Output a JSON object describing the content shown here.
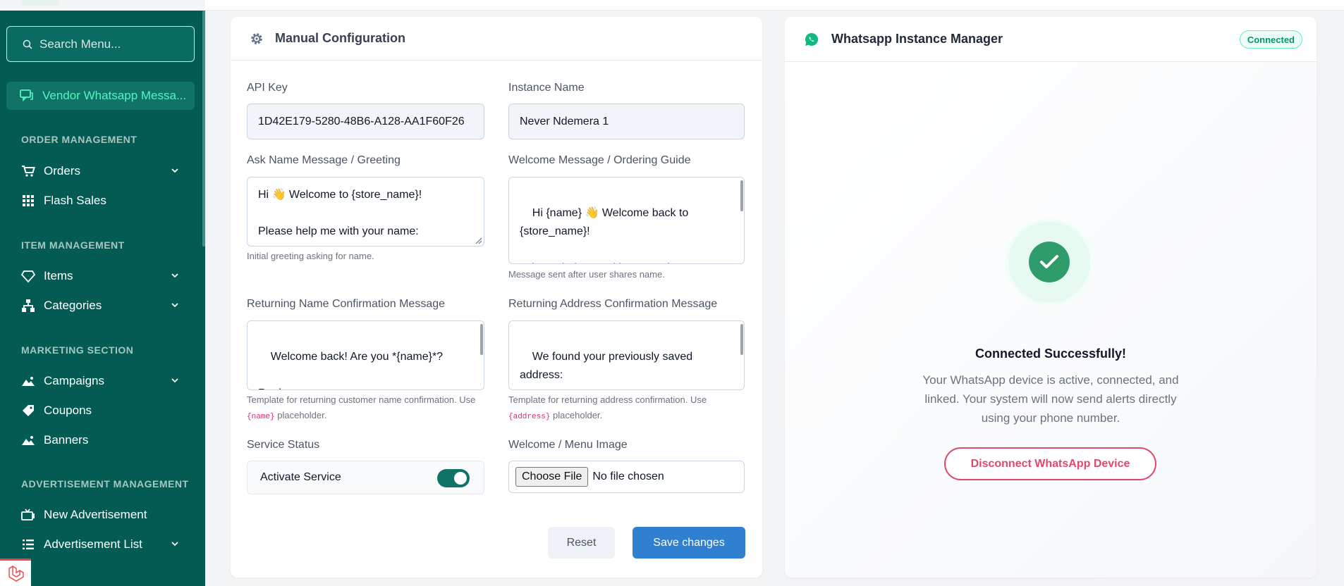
{
  "sidebar": {
    "search_placeholder": "Search Menu...",
    "active_item": "Vendor Whatsapp Messa...",
    "sections": {
      "order": "ORDER MANAGEMENT",
      "item": "ITEM MANAGEMENT",
      "marketing": "MARKETING SECTION",
      "ads": "ADVERTISEMENT MANAGEMENT"
    },
    "items": {
      "orders": "Orders",
      "flash_sales": "Flash Sales",
      "items": "Items",
      "categories": "Categories",
      "campaigns": "Campaigns",
      "coupons": "Coupons",
      "banners": "Banners",
      "new_ad": "New Advertisement",
      "ad_list": "Advertisement List"
    }
  },
  "config": {
    "title": "Manual Configuration",
    "api_key_label": "API Key",
    "api_key_value": "1D42E179-5280-48B6-A128-AA1F60F26",
    "instance_label": "Instance Name",
    "instance_value": "Never Ndemera 1",
    "ask_name_label": "Ask Name Message / Greeting",
    "ask_name_value": "Hi 👋 Welcome to {store_name}!\n\nPlease help me with your name:",
    "ask_name_help": "Initial greeting asking for name.",
    "welcome_label": "Welcome Message / Ordering Guide",
    "welcome_value": "Hi {name} 👋 Welcome back to {store_name}!\n\n*Please help me with your order.*",
    "welcome_help": "Message sent after user shares name.",
    "ret_name_label": "Returning Name Confirmation Message",
    "ret_name_value": "Welcome back! Are you *{name}*?\n\nReply:\n✓YES✓ to proceed with this name",
    "ret_name_help_pre": "Template for returning customer name confirmation. Use",
    "ret_name_help_code": "{name}",
    "ret_name_help_post": "placeholder.",
    "ret_addr_label": "Returning Address Confirmation Message",
    "ret_addr_value": "We found your previously saved address:\n\n*{address}*",
    "ret_addr_help_pre": "Template for returning address confirmation. Use",
    "ret_addr_help_code": "{address}",
    "ret_addr_help_post": "placeholder.",
    "service_label": "Service Status",
    "service_toggle_label": "Activate Service",
    "service_active": true,
    "image_label": "Welcome / Menu Image",
    "choose_file": "Choose File",
    "no_file": "No file chosen",
    "reset": "Reset",
    "save": "Save changes"
  },
  "instance": {
    "title": "Whatsapp Instance Manager",
    "badge": "Connected",
    "success_title": "Connected Successfully!",
    "success_desc": "Your WhatsApp device is active, connected, and linked. Your system will now send alerts directly using your phone number.",
    "disconnect": "Disconnect WhatsApp Device"
  },
  "colors": {
    "sidebar_bg": "#035b53",
    "accent": "#57f2c3",
    "primary": "#2f80d1",
    "success": "#2e9b6b",
    "danger": "#e0496b"
  }
}
